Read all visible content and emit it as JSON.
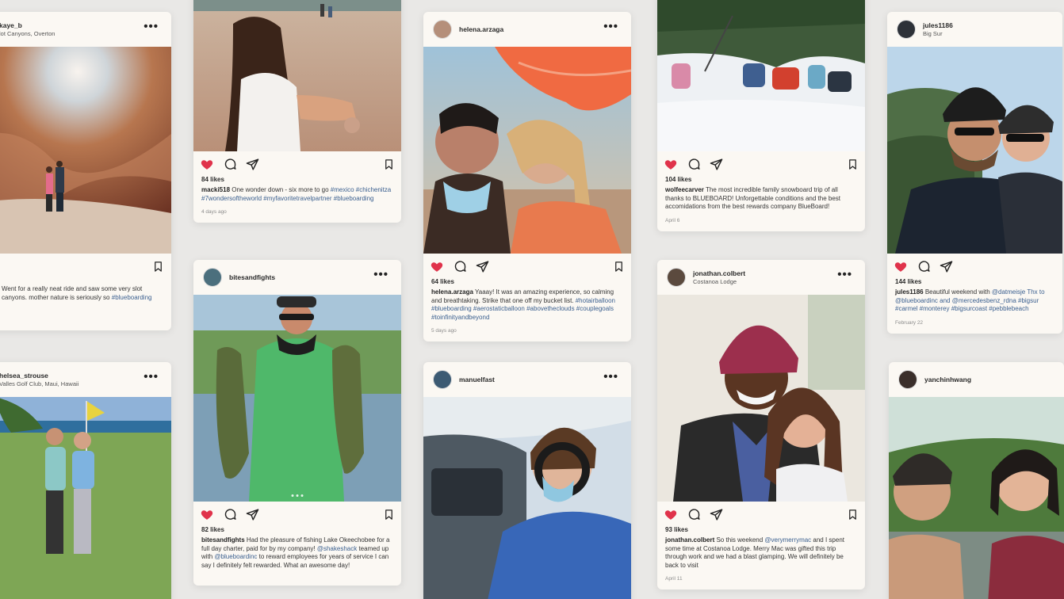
{
  "colors": {
    "heart": "#e0334b",
    "tag": "#3a5f8f",
    "card": "#fbf8f3",
    "background": "#e9e8e6"
  },
  "more_label": "•••",
  "posts": [
    {
      "username": "kaye_b",
      "location": "lot Canyons, Overton",
      "likes": "",
      "caption_user": "",
      "caption": "Went for a really neat ride and saw some very slot canyons. mother nature is seriously so",
      "tags": "#blueboarding",
      "date": ""
    },
    {
      "username": "",
      "location": "",
      "likes": "84 likes",
      "caption_user": "macki518",
      "caption": " One wonder down - six more to go ",
      "tags": "#mexico #chichenitza #7wondersoftheworld #myfavoritetravelpartner #blueboarding",
      "date": "4 days ago"
    },
    {
      "username": "helena.arzaga",
      "location": "",
      "likes": "64 likes",
      "caption_user": "helena.arzaga",
      "caption": " Yaaay! It was an amazing experience, so calming and breathtaking. Strike that one off my bucket list. ",
      "tags": "#hotairballoon #blueboarding #aerostaticballoon #abovetheclouds #couplegoals #toinfinityandbeyond",
      "date": "5 days ago"
    },
    {
      "username": "",
      "location": "",
      "likes": "104 likes",
      "caption_user": "wolfeecarver",
      "caption": " The most incredible family snowboard trip of all thanks to BLUEBOARD! Unforgettable conditions and the best accomidations from the best rewards company BlueBoard!",
      "tags": "",
      "date": "April 6"
    },
    {
      "username": "jules1186",
      "location": "Big Sur",
      "likes": "144 likes",
      "caption_user": "jules1186",
      "caption": " Beautiful weekend with ",
      "tags": "@datmeisje Thx to @blueboardinc and @mercedesbenz_rdna #bigsur #carmel #monterey #bigsurcoast #pebblebeach",
      "date": "February 22"
    },
    {
      "username": "bitesandfights",
      "location": "",
      "likes": "82 likes",
      "caption_user": "bitesandfights",
      "caption": " Had the pleasure of fishing Lake Okeechobee for a full day charter, paid for by my company! ",
      "tags": "@shakeshack",
      "caption2": " teamed up with ",
      "tags2": "@blueboardinc",
      "caption3": " to reward employees for years of service I can say I definitely felt rewarded. What an awesome day!",
      "date": ""
    },
    {
      "username": "jonathan.colbert",
      "location": "Costanoa Lodge",
      "likes": "93 likes",
      "caption_user": "jonathan.colbert",
      "caption": " So this weekend ",
      "tags": "@verymerrymac",
      "caption2": " and I spent some time at Costanoa Lodge. Merry Mac was gifted this trip through work and we had a blast glamping. We will definitely be back to visit",
      "date": "April 11"
    },
    {
      "username": "helsea_strouse",
      "location": "Valles Golf Club, Maui, Hawaii",
      "likes": "",
      "caption_user": "",
      "caption": "",
      "tags": "",
      "date": ""
    },
    {
      "username": "manuelfast",
      "location": "",
      "likes": "",
      "caption_user": "",
      "caption": "",
      "tags": "",
      "date": ""
    },
    {
      "username": "yanchinhwang",
      "location": "",
      "likes": "",
      "caption_user": "",
      "caption": "",
      "tags": "",
      "date": ""
    }
  ]
}
